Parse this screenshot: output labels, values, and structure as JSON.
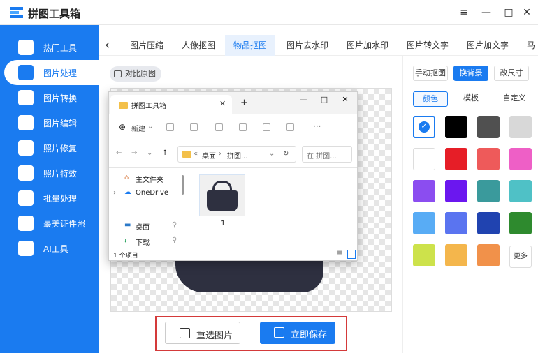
{
  "app": {
    "title": "拼图工具箱",
    "window_controls": [
      "≡",
      "—",
      "□",
      "✕"
    ]
  },
  "sidebar": {
    "items": [
      {
        "label": "热门工具",
        "icon": "hot-tools-icon"
      },
      {
        "label": "图片处理",
        "icon": "image-process-icon",
        "active": true
      },
      {
        "label": "图片转换",
        "icon": "image-convert-icon"
      },
      {
        "label": "图片编辑",
        "icon": "image-edit-icon"
      },
      {
        "label": "照片修复",
        "icon": "photo-repair-icon"
      },
      {
        "label": "照片特效",
        "icon": "photo-effect-icon"
      },
      {
        "label": "批量处理",
        "icon": "batch-icon"
      },
      {
        "label": "最美证件照",
        "icon": "id-photo-icon"
      },
      {
        "label": "AI工具",
        "icon": "ai-icon"
      }
    ]
  },
  "tabs": [
    "图片压缩",
    "人像抠图",
    "物品抠图",
    "图片去水印",
    "图片加水印",
    "图片转文字",
    "图片加文字",
    "马"
  ],
  "active_tab": "物品抠图",
  "compare_label": "对比原图",
  "right_panel": {
    "modes": [
      "手动抠图",
      "换背景",
      "改尺寸"
    ],
    "active_mode": "换背景",
    "subtabs": [
      "颜色",
      "模板",
      "自定义"
    ],
    "active_subtab": "颜色",
    "colors": [
      "#ffffff",
      "#000000",
      "#505050",
      "#d8d8d8",
      "#ffffff",
      "#e61e27",
      "#ee5a5a",
      "#ee5fc6",
      "#8b4df0",
      "#6b17ef",
      "#3a9a9c",
      "#4fc1c6",
      "#58acf5",
      "#5a74f0",
      "#2043b0",
      "#2e8a2e",
      "#cde24b",
      "#f4b64c",
      "#f1914a"
    ],
    "more_label": "更多"
  },
  "actions": {
    "reselect": "重选图片",
    "save": "立即保存"
  },
  "dialog": {
    "tab_title": "拼图工具箱",
    "new_label": "新建",
    "breadcrumb": [
      "桌面",
      "拼图..."
    ],
    "search_placeholder": "在 拼图...",
    "nav": [
      {
        "label": "主文件夹",
        "icon": "home-icon"
      },
      {
        "label": "OneDrive",
        "icon": "cloud-icon"
      },
      {
        "label": "桌面",
        "icon": "desktop-icon"
      },
      {
        "label": "下载",
        "icon": "download-icon"
      }
    ],
    "file": {
      "name": "1"
    },
    "status": "1 个项目"
  }
}
